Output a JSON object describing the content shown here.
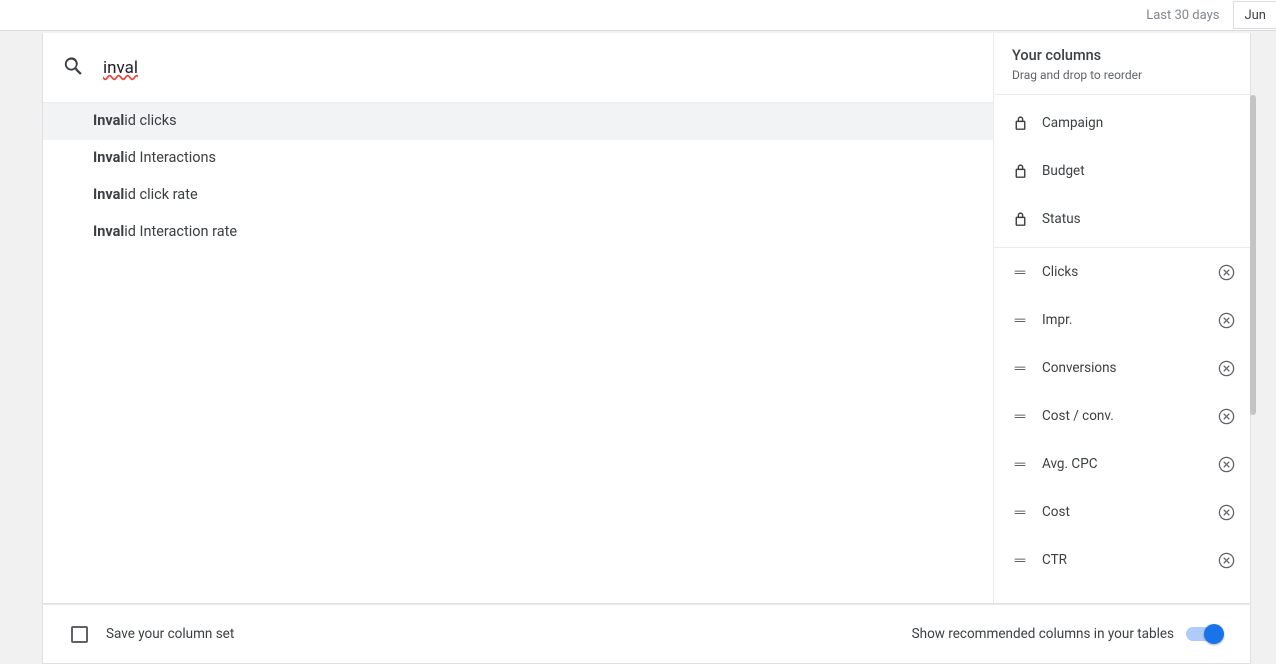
{
  "topbar": {
    "date_range_label": "Last 30 days",
    "jun_button": "Jun"
  },
  "search": {
    "value": "inval",
    "suggestions": [
      {
        "match": "Inval",
        "rest": "id clicks",
        "highlighted": true
      },
      {
        "match": "Inval",
        "rest": "id Interactions",
        "highlighted": false
      },
      {
        "match": "Inval",
        "rest": "id click rate",
        "highlighted": false
      },
      {
        "match": "Inval",
        "rest": "id Interaction rate",
        "highlighted": false
      }
    ]
  },
  "your_columns": {
    "title": "Your columns",
    "subtitle": "Drag and drop to reorder",
    "locked": [
      {
        "label": "Campaign"
      },
      {
        "label": "Budget"
      },
      {
        "label": "Status"
      }
    ],
    "draggable": [
      {
        "label": "Clicks"
      },
      {
        "label": "Impr."
      },
      {
        "label": "Conversions"
      },
      {
        "label": "Cost / conv."
      },
      {
        "label": "Avg. CPC"
      },
      {
        "label": "Cost"
      },
      {
        "label": "CTR"
      }
    ]
  },
  "footer": {
    "save_label": "Save your column set",
    "recommended_label": "Show recommended columns in your tables",
    "toggle_on": true
  }
}
